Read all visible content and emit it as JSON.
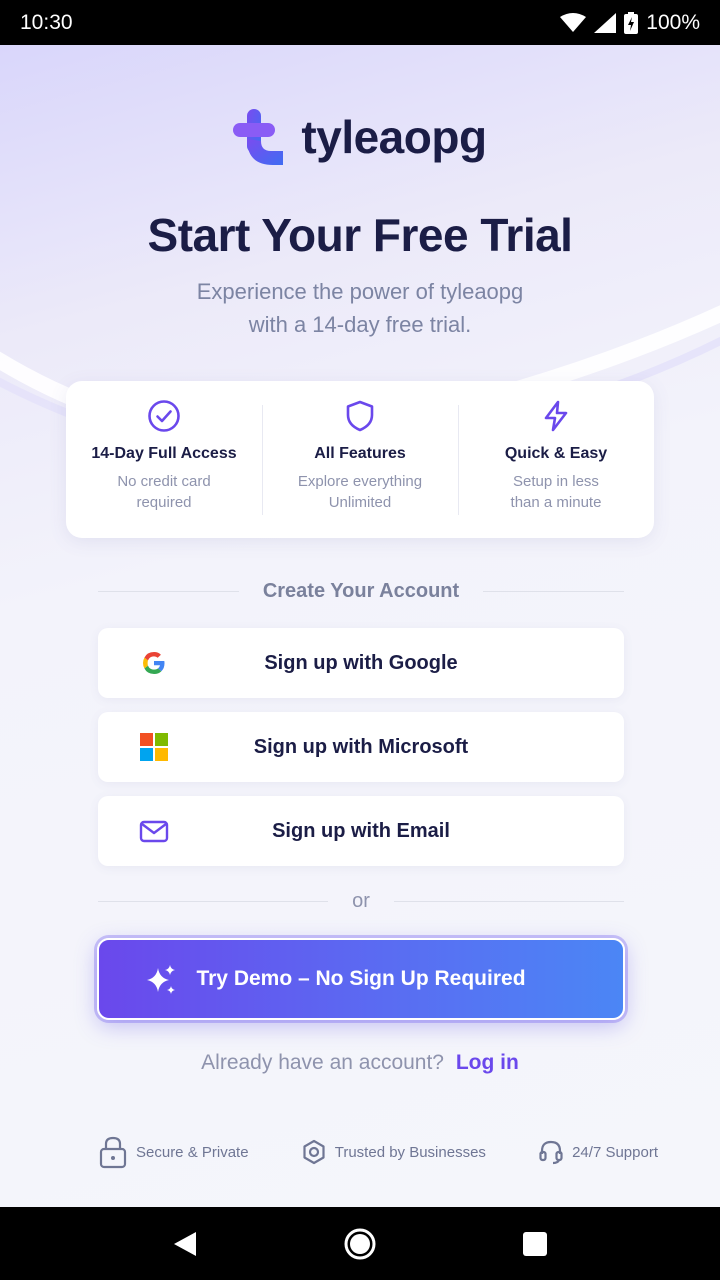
{
  "status_bar": {
    "time": "10:30",
    "battery": "100%"
  },
  "brand": {
    "name": "tyleaopg"
  },
  "hero": {
    "title": "Start Your Free Trial",
    "subtitle_line1": "Experience the power of tyleaopg",
    "subtitle_line2": "with a 14-day free trial."
  },
  "features": [
    {
      "icon": "check-circle-icon",
      "title": "14-Day Full Access",
      "desc_line1": "No credit card",
      "desc_line2": "required"
    },
    {
      "icon": "shield-icon",
      "title": "All Features",
      "desc_line1": "Explore everything",
      "desc_line2": "Unlimited"
    },
    {
      "icon": "lightning-icon",
      "title": "Quick & Easy",
      "desc_line1": "Setup in less",
      "desc_line2": "than a minute"
    }
  ],
  "account": {
    "section_label": "Create Your Account",
    "google_label": "Sign up with Google",
    "microsoft_label": "Sign up with Microsoft",
    "email_label": "Sign up with Email",
    "or_label": "or",
    "demo_label": "Try Demo – No Sign Up Required",
    "login_prompt": "Already have an account?",
    "login_link": "Log in"
  },
  "trust": [
    {
      "icon": "lock-icon",
      "label": "Secure & Private"
    },
    {
      "icon": "badge-icon",
      "label": "Trusted by Businesses"
    },
    {
      "icon": "headset-icon",
      "label": "24/7 Support"
    }
  ],
  "colors": {
    "accent": "#6a48ec",
    "accent_blue": "#4b86f5",
    "text_dark": "#1b1d46",
    "text_muted": "#8e93ad"
  }
}
